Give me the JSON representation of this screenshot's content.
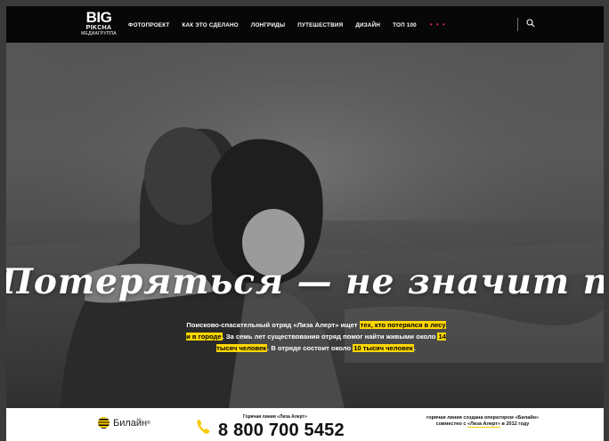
{
  "nav": {
    "logo": {
      "big": "BIG",
      "sub": "PIKCHA",
      "sub2": "МЕДИАГРУППА"
    },
    "items": [
      {
        "label": "ФОТОПРОЕКТ"
      },
      {
        "label": "КАК ЭТО СДЕЛАНО"
      },
      {
        "label": "ЛОНГРИДЫ"
      },
      {
        "label": "ПУТЕШЕСТВИЯ"
      },
      {
        "label": "ДИЗАЙН"
      },
      {
        "label": "ТОП 100"
      }
    ],
    "more": "• • •",
    "accent_color": "#e0304a"
  },
  "hero": {
    "title": "Потеряться — не значит пропасть",
    "text": {
      "part1": "Поисково-спасательный отряд «Лиза Алерт» ищет ",
      "hl1": "тех, кто потерялся в лесу и в городе",
      "part2": ". За семь лет существования отряд помог найти живыми около ",
      "hl2": "14 тысяч человек",
      "part3": ". В отряде состоит около ",
      "hl3": "10 тысяч человек",
      "part4": "."
    },
    "highlight_color": "#ffd700"
  },
  "footer": {
    "brand": "Билайн",
    "brand_tm": "®",
    "hotline_label": "Горячая линия «Лиза Алерт»",
    "phone": "8 800 700 5452",
    "note_part1": "горячая линия создана оператором «Билайн» совместно с ",
    "note_highlight": "«Лиза Алерт»",
    "note_part2": " в 2012 году",
    "brand_color": "#f9c900"
  }
}
